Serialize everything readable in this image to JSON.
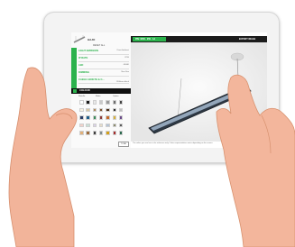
{
  "configurator": {
    "fixture_name": "HAJO",
    "reset_label": "RESET ALL",
    "options": [
      {
        "label": "LIGHT EMISSION",
        "value": "Direct/indirect"
      },
      {
        "label": "IP RATE",
        "value": "IP20"
      },
      {
        "label": "LED",
        "value": "4000K"
      },
      {
        "label": "DIMMING",
        "value": "Non Dim"
      },
      {
        "label": "CABLE LENGTH & C...",
        "value": "1500mm black"
      }
    ],
    "colour_label": "COLOUR",
    "filters": [
      "Metallic",
      "Matte",
      "Option"
    ],
    "total_label": "TOTAL",
    "swatch_colors": [
      "#ffffff",
      "#1a1a1a",
      "#e8e8e8",
      "#c9c9c9",
      "#9a9a9a",
      "#6d6d6d",
      "#444444",
      "#f5f0e1",
      "#d9c7a3",
      "#b08b5a",
      "#7a5230",
      "#4a2f1a",
      "#2b2b2b",
      "#c0c0c0",
      "#2c3e66",
      "#1f5f8b",
      "#3c8d5a",
      "#8b3a3a",
      "#c46a2b",
      "#d8b23a",
      "#6b4c8a",
      "#f2d1c9",
      "#c8e0d6",
      "#d9d0e6",
      "#e6dcc8",
      "#b5c4d6",
      "#8a8a6b",
      "#5a5a5a",
      "#e0b07a",
      "#9c6b3c",
      "#3d3d3d",
      "#7f8c8d",
      "#d4a017",
      "#a62c2c",
      "#2d6a4f"
    ]
  },
  "viewport": {
    "dimension_tag": "PIN: 9500 · 250 · 1A",
    "export_label": "EXPORT IMAGE",
    "disclaimer": "The colour you see here is for reference only. Colour representation varies depending on the screen."
  },
  "colors": {
    "accent": "#2bb24c",
    "dark": "#1c1c1c",
    "skin": "#f2b49a"
  }
}
